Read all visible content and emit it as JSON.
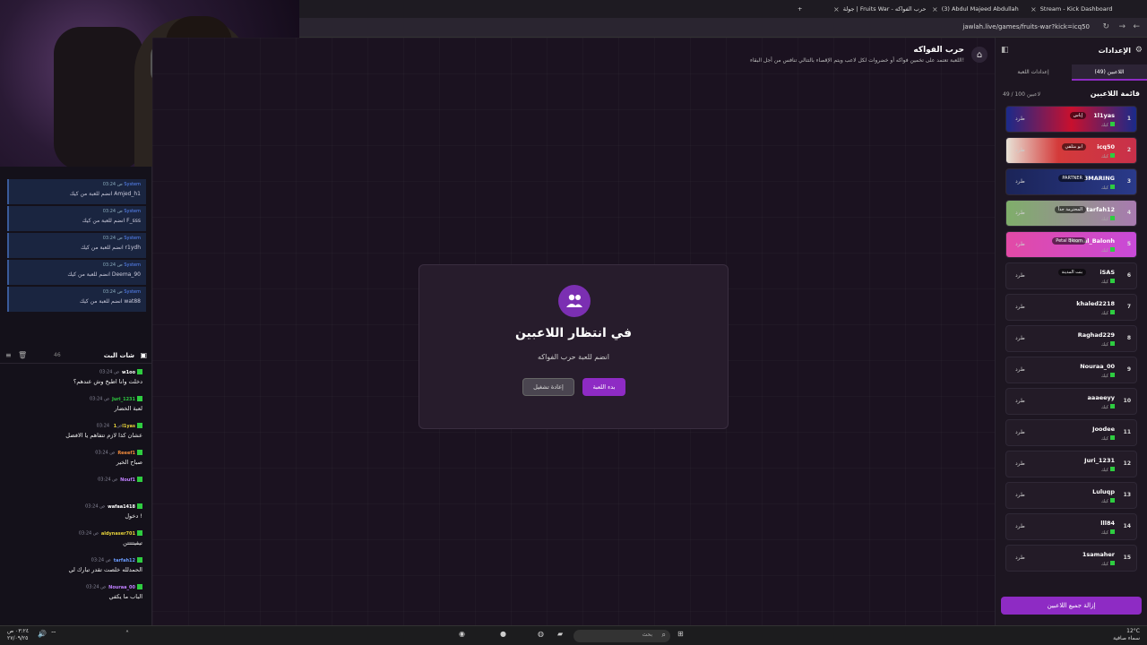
{
  "browser": {
    "tabs": [
      {
        "label": "Stream - Kick Dashboard"
      },
      {
        "label": "(3) Abdul Majeed Abdullah"
      },
      {
        "label": "جولة | Fruits War - حرب الفواكه"
      }
    ],
    "url": "jawlah.live/games/fruits-war?kick=icq50"
  },
  "chat": {
    "system_messages": [
      {
        "time": "03:24 ص",
        "user": "System",
        "text": "انضم للعبة من كيك Amjed_h1"
      },
      {
        "time": "03:24 ص",
        "user": "System",
        "text": "انضم للعبة من كيك F_sss"
      },
      {
        "time": "03:24 ص",
        "user": "System",
        "text": "انضم للعبة من كيك r1ydh"
      },
      {
        "time": "03:24 ص",
        "user": "System",
        "text": "انضم للعبة من كيك Deema_90"
      },
      {
        "time": "03:24 ص",
        "user": "System",
        "text": "انضم للعبة من كيك wat88"
      }
    ],
    "title": "شات البث",
    "count": "46",
    "messages": [
      {
        "time": "03:24 ص",
        "user": "w1oo",
        "text": "دخلت وانا اطبخ وش عندهم؟",
        "color": "#ffffff"
      },
      {
        "time": "03:24 ص",
        "user": "Juri_1231",
        "text": "لعبة الخضار",
        "color": "#2ecc40"
      },
      {
        "time": "03:24 ص",
        "user": "1l1yas",
        "text": "عشان كذا لازم تتفاهم يا الافضل",
        "color": "#e6d23a"
      },
      {
        "time": "03:24 ص",
        "user": "Reeef1",
        "text": "صباح الخير",
        "color": "#f08a3c"
      },
      {
        "time": "03:24 ص",
        "user": "Nouf1",
        "text": "",
        "color": "#c080ff"
      },
      {
        "time": "03:24 ص",
        "user": "wafaa1418",
        "text": "دخول !",
        "color": "#ffffff"
      },
      {
        "time": "03:24 ص",
        "user": "aldynaser701",
        "text": "تيفيتتتتن",
        "color": "#e6d23a"
      },
      {
        "time": "03:24 ص",
        "user": "tarfah12",
        "text": "الحمدلله خلصت تقدر تبارك لي",
        "color": "#6a9cff"
      },
      {
        "time": "03:24 ص",
        "user": "Nouraa_00",
        "text": "الباب ما يكفي",
        "color": "#c080ff"
      }
    ]
  },
  "game": {
    "title": "حرب الفواكه",
    "description": "اللعبة تعتمد على تخمين فواكه أو خضروات لكل لاعب ويتم الإقصاء بالتتالي تنافس من أجل البقاء!",
    "modal_title": "في انتظار اللاعبين",
    "modal_subtitle": "انضم للعبة حرب الفواكه",
    "start_label": "بدء اللعبة",
    "restart_label": "إعادة تشغيل"
  },
  "sidebar": {
    "title": "الإعدادات",
    "tab_players": "اللاعبين (49)",
    "tab_settings": "إعدادات اللعبة",
    "list_title": "قائمة اللاعبين",
    "list_count": "49 / 100 لاعبين",
    "status_text": "كيك",
    "kick_label": "طرد",
    "clear_label": "إزالة جميع اللاعبين",
    "players": [
      {
        "num": "1",
        "name": "1l1yas",
        "tag": "إياس",
        "bg": "linear-gradient(90deg,#1a2a8a,#c8102e 50%,#1a2a8a)"
      },
      {
        "num": "2",
        "name": "icq50",
        "tag": "ابو متلفي",
        "bg": "linear-gradient(90deg,#e8e2d6,#d43a3a 40%,#c8304a)"
      },
      {
        "num": "3",
        "name": "3MARING",
        "tag": "PARTNER",
        "bg": "linear-gradient(90deg,#1b2458,#2a3a8a)"
      },
      {
        "num": "4",
        "name": "tarfah12",
        "tag": "المحترمة جداً",
        "bg": "linear-gradient(90deg,#7fae6a,#a87ab0)"
      },
      {
        "num": "5",
        "name": "Manal_Balonh",
        "tag": "Petal Bloom",
        "bg": "linear-gradient(90deg,#e24aa6,#c84ad8)"
      },
      {
        "num": "6",
        "name": "iSAS",
        "tag": "بنت المدينة",
        "bg": "#231b27"
      },
      {
        "num": "7",
        "name": "khaled2218",
        "tag": "",
        "bg": "#231b27"
      },
      {
        "num": "8",
        "name": "Raghad229",
        "tag": "",
        "bg": "#231b27"
      },
      {
        "num": "9",
        "name": "Nouraa_00",
        "tag": "",
        "bg": "#231b27"
      },
      {
        "num": "10",
        "name": "aaaeeyy",
        "tag": "",
        "bg": "#231b27"
      },
      {
        "num": "11",
        "name": "Joodee",
        "tag": "",
        "bg": "#231b27"
      },
      {
        "num": "12",
        "name": "Juri_1231",
        "tag": "",
        "bg": "#231b27"
      },
      {
        "num": "13",
        "name": "Luluqp",
        "tag": "",
        "bg": "#231b27"
      },
      {
        "num": "14",
        "name": "lll84",
        "tag": "",
        "bg": "#231b27"
      },
      {
        "num": "15",
        "name": "1samaher",
        "tag": "",
        "bg": "#231b27"
      }
    ]
  },
  "taskbar": {
    "time": "٠٣:٢٤ ص",
    "date": "٢٧/٠٩/٢٥",
    "search_placeholder": "بحث",
    "weather_temp": "12°C",
    "weather_desc": "سماء صافية"
  }
}
